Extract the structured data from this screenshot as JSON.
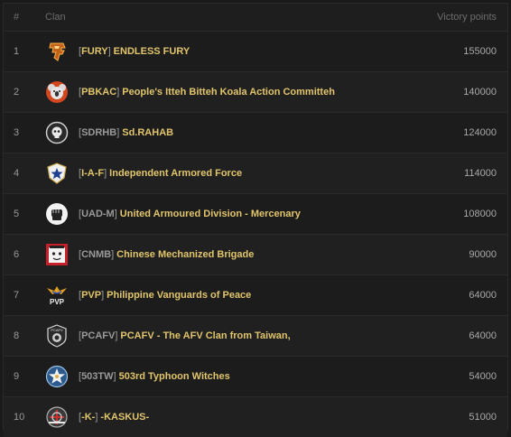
{
  "header": {
    "num": "#",
    "clan": "Clan",
    "points": "Victory points"
  },
  "rows": [
    {
      "rank": "1",
      "tag": "FURY",
      "tag_color": "#e1c56c",
      "name": "ENDLESS FURY",
      "points": "155000",
      "emblem": "fury-emblem-icon"
    },
    {
      "rank": "2",
      "tag": "PBKAC",
      "tag_color": "#e1c56c",
      "name": "People's Itteh Bitteh Koala Action Committeh",
      "points": "140000",
      "emblem": "koala-emblem-icon"
    },
    {
      "rank": "3",
      "tag": "SDRHB",
      "tag_color": "#9a9a9a",
      "name": "Sd.RAHAB",
      "points": "124000",
      "emblem": "skull-emblem-icon"
    },
    {
      "rank": "4",
      "tag": "I-A-F",
      "tag_color": "#e1c56c",
      "name": "Independent Armored Force",
      "points": "114000",
      "emblem": "star-shield-emblem-icon"
    },
    {
      "rank": "5",
      "tag": "UAD-M",
      "tag_color": "#9a9a9a",
      "name": "United Armoured Division - Mercenary",
      "points": "108000",
      "emblem": "fist-emblem-icon"
    },
    {
      "rank": "6",
      "tag": "CNMB",
      "tag_color": "#9a9a9a",
      "name": "Chinese Mechanized Brigade",
      "points": "90000",
      "emblem": "cartoon-emblem-icon"
    },
    {
      "rank": "7",
      "tag": "PVP",
      "tag_color": "#e1c56c",
      "name": "Philippine Vanguards of Peace",
      "points": "64000",
      "emblem": "pvp-eagle-emblem-icon"
    },
    {
      "rank": "8",
      "tag": "PCAFV",
      "tag_color": "#9a9a9a",
      "name": "PCAFV - The AFV Clan from Taiwan,",
      "points": "64000",
      "emblem": "pcafv-badge-emblem-icon"
    },
    {
      "rank": "9",
      "tag": "503TW",
      "tag_color": "#9a9a9a",
      "name": "503rd Typhoon Witches",
      "points": "54000",
      "emblem": "star-badge-emblem-icon"
    },
    {
      "rank": "10",
      "tag": "-K-",
      "tag_color": "#e1c56c",
      "name": "-KASKUS-",
      "points": "51000",
      "emblem": "kaskus-emblem-icon"
    }
  ],
  "brackets": {
    "open": "[",
    "close": "]"
  }
}
